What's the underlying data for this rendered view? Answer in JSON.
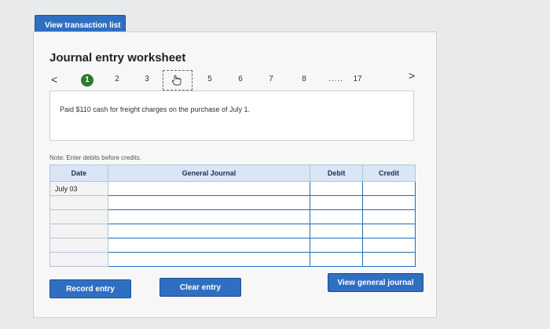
{
  "top_button": {
    "label": "View transaction list"
  },
  "worksheet": {
    "title": "Journal entry worksheet",
    "nav": {
      "prev": "<",
      "next": ">",
      "steps": [
        "1",
        "2",
        "3",
        "",
        "5",
        "6",
        "7",
        "8",
        "17"
      ],
      "ellipsis": "....."
    },
    "description": "Paid $110 cash for freight charges on the purchase of July 1.",
    "note": "Note: Enter debits before credits.",
    "table": {
      "headers": [
        "Date",
        "General Journal",
        "Debit",
        "Credit"
      ],
      "rows": [
        [
          "July 03",
          "",
          "",
          ""
        ],
        [
          "",
          "",
          "",
          ""
        ],
        [
          "",
          "",
          "",
          ""
        ],
        [
          "",
          "",
          "",
          ""
        ],
        [
          "",
          "",
          "",
          ""
        ],
        [
          "",
          "",
          "",
          ""
        ]
      ]
    },
    "buttons": {
      "record": "Record entry",
      "clear": "Clear entry",
      "view_general": "View general journal"
    }
  }
}
